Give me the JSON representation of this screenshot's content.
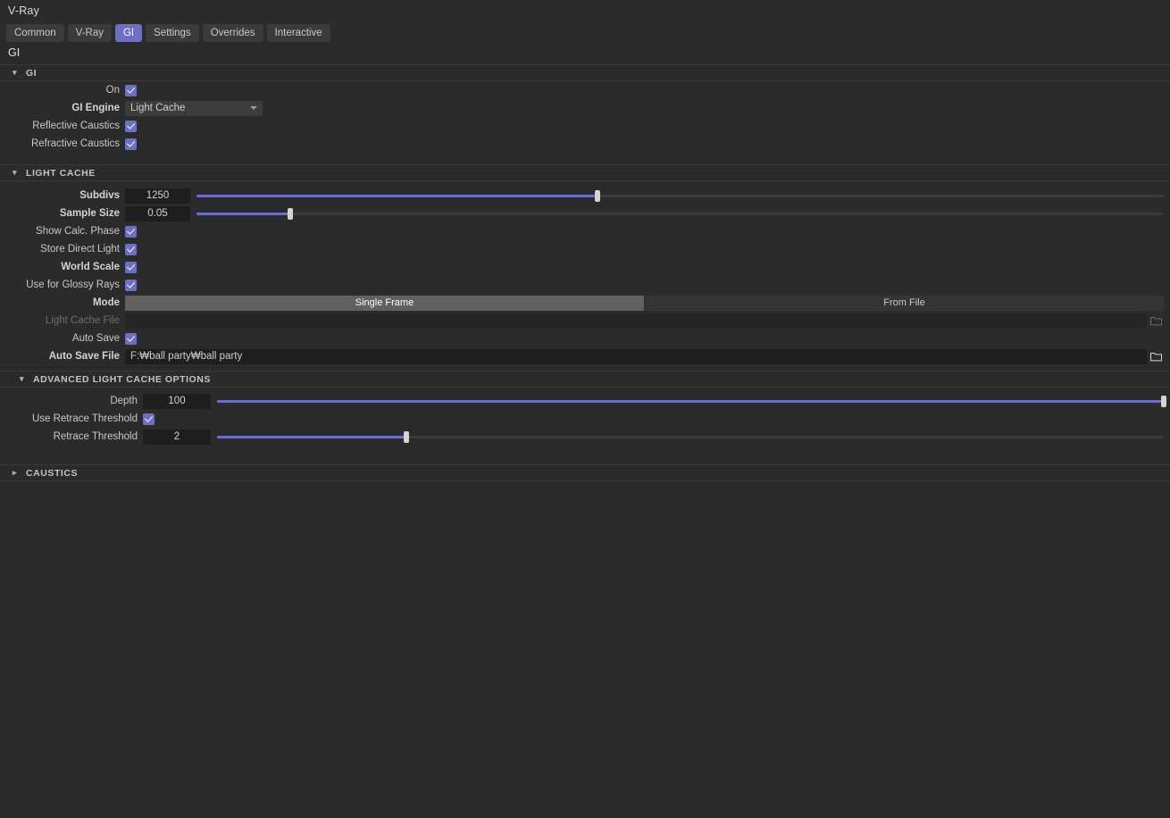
{
  "app": {
    "title": "V-Ray",
    "page_title": "GI"
  },
  "tabs": [
    {
      "label": "Common",
      "active": false
    },
    {
      "label": "V-Ray",
      "active": false
    },
    {
      "label": "GI",
      "active": true
    },
    {
      "label": "Settings",
      "active": false
    },
    {
      "label": "Overrides",
      "active": false
    },
    {
      "label": "Interactive",
      "active": false
    }
  ],
  "colors": {
    "accent": "#6c6fc4",
    "background": "#2b2b2b",
    "field": "#1e1e1e",
    "knob": "#d7d5d2"
  },
  "sections": {
    "gi": {
      "header": "GI",
      "expanded": true,
      "chevron": "chevron-down-icon",
      "rows": {
        "on": {
          "label": "On",
          "checked": true
        },
        "gi_engine": {
          "label": "GI Engine",
          "value": "Light Cache"
        },
        "reflective_caustics": {
          "label": "Reflective Caustics",
          "checked": true
        },
        "refractive_caustics": {
          "label": "Refractive Caustics",
          "checked": true
        }
      }
    },
    "light_cache": {
      "header": "LIGHT CACHE",
      "expanded": true,
      "chevron": "chevron-down-icon",
      "rows": {
        "subdivs": {
          "label": "Subdivs",
          "value": "1250",
          "slider_pct": 41.5
        },
        "sample_size": {
          "label": "Sample Size",
          "value": "0.05",
          "slider_pct": 9.7
        },
        "show_calc_phase": {
          "label": "Show Calc. Phase",
          "checked": true
        },
        "store_direct_light": {
          "label": "Store Direct Light",
          "checked": true
        },
        "world_scale": {
          "label": "World Scale",
          "checked": true
        },
        "use_for_glossy_rays": {
          "label": "Use for Glossy Rays",
          "checked": true
        },
        "mode": {
          "label": "Mode",
          "options": [
            {
              "label": "Single Frame",
              "selected": true
            },
            {
              "label": "From File",
              "selected": false
            }
          ]
        },
        "light_cache_file": {
          "label": "Light Cache File",
          "value": "",
          "disabled": true,
          "browse_icon": "folder-icon"
        },
        "auto_save": {
          "label": "Auto Save",
          "checked": true
        },
        "auto_save_file": {
          "label": "Auto Save File",
          "value": "F:₩ball party₩ball party",
          "disabled": false,
          "browse_icon": "folder-icon"
        }
      }
    },
    "advanced_light_cache": {
      "header": "ADVANCED LIGHT CACHE OPTIONS",
      "expanded": true,
      "chevron": "chevron-down-icon",
      "rows": {
        "depth": {
          "label": "Depth",
          "value": "100",
          "slider_pct": 100
        },
        "use_retrace_threshold": {
          "label": "Use Retrace Threshold",
          "checked": true
        },
        "retrace_threshold": {
          "label": "Retrace Threshold",
          "value": "2",
          "slider_pct": 20
        }
      }
    },
    "caustics": {
      "header": "CAUSTICS",
      "expanded": false,
      "chevron": "chevron-right-icon"
    }
  }
}
